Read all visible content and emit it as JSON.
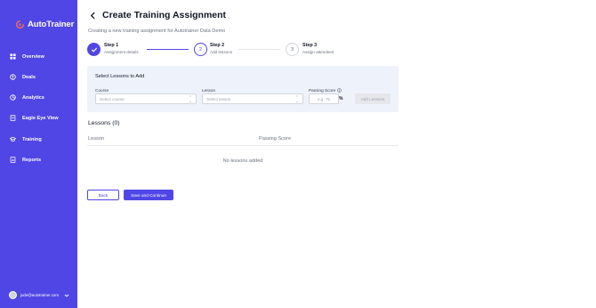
{
  "brand": {
    "name": "AutoTrainer",
    "accent": "#5046e5",
    "logo_color": "#f26b5b"
  },
  "sidebar": {
    "items": [
      {
        "label": "Overview",
        "icon": "dashboard-icon"
      },
      {
        "label": "Deals",
        "icon": "deals-icon"
      },
      {
        "label": "Analytics",
        "icon": "analytics-icon"
      },
      {
        "label": "Eagle Eye View",
        "icon": "document-icon"
      },
      {
        "label": "Training",
        "icon": "graduation-cap-icon"
      },
      {
        "label": "Reports",
        "icon": "reports-icon"
      }
    ],
    "user_email": "jude@autotrainer.com"
  },
  "header": {
    "title": "Create Training Assignment",
    "subtitle": "Creating a new training assignment for Autotrainer Data Demo"
  },
  "steps": [
    {
      "title": "Step 1",
      "desc": "Assignment details",
      "state": "done",
      "number": "1"
    },
    {
      "title": "Step 2",
      "desc": "Add lessons",
      "state": "current",
      "number": "2"
    },
    {
      "title": "Step 3",
      "desc": "Assign attendees",
      "state": "todo",
      "number": "3"
    }
  ],
  "panel": {
    "title": "Select Lessons to Add",
    "course_label": "Course",
    "course_placeholder": "Select course",
    "lesson_label": "Lesson",
    "lesson_placeholder": "Select lesson",
    "score_label": "Passing Score",
    "score_placeholder": "e.g. 75",
    "percent_symbol": "%",
    "add_button": "Add Lessons"
  },
  "lessons": {
    "heading": "Lessons (0)",
    "columns": [
      "Lesson",
      "Passing Score"
    ],
    "empty_text": "No lessons added"
  },
  "actions": {
    "back": "Back",
    "save": "Save and Continue"
  }
}
